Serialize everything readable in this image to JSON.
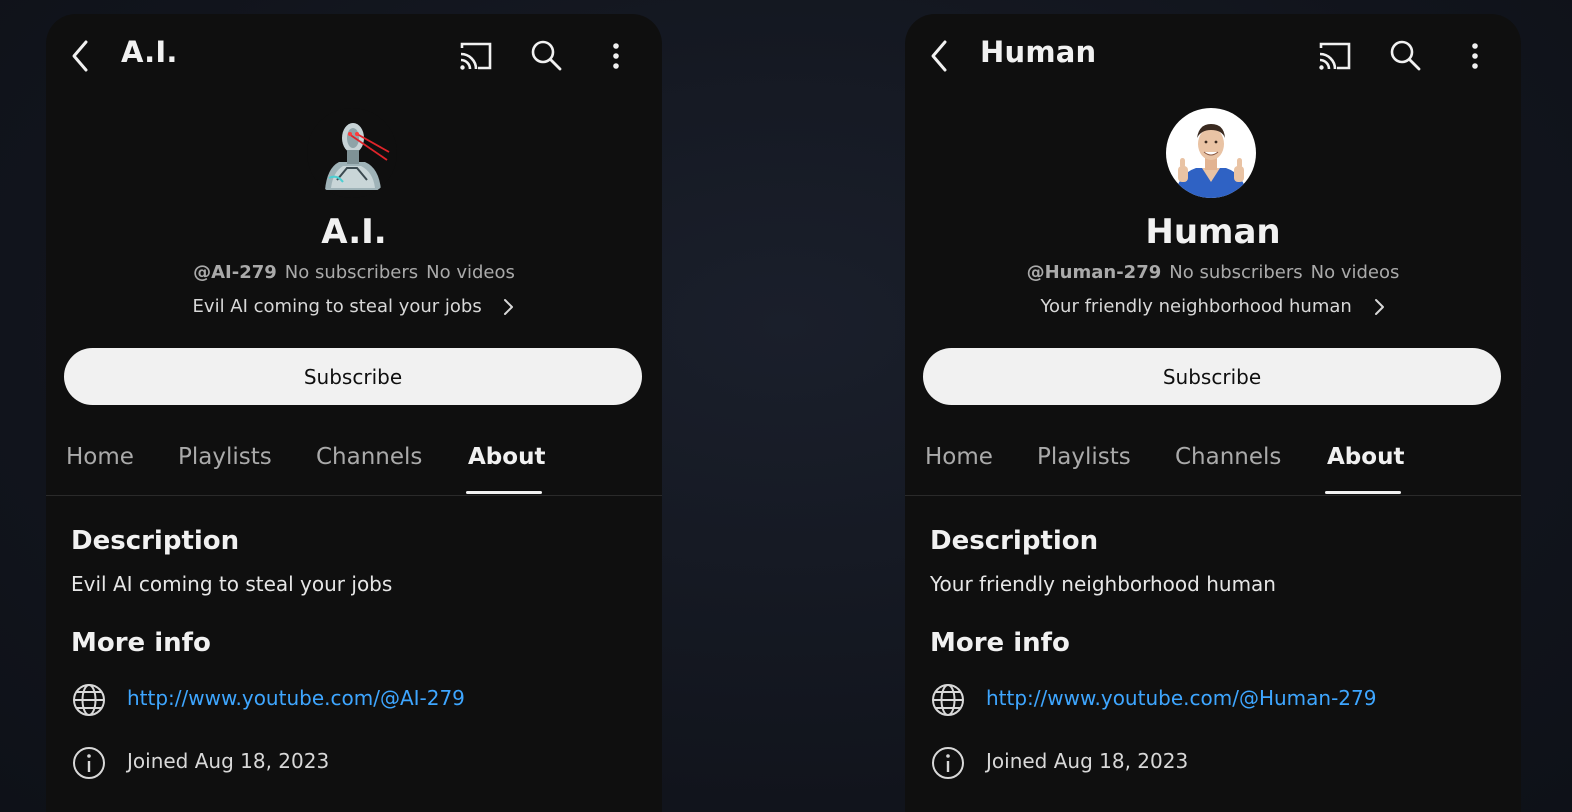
{
  "panels": [
    {
      "top_title": "A.I.",
      "channel_name": "A.I.",
      "handle": "@AI-279",
      "subscribers": "No subscribers",
      "videos": "No videos",
      "tagline": "Evil AI coming to steal your jobs",
      "subscribe_label": "Subscribe",
      "tabs": [
        "Home",
        "Playlists",
        "Channels",
        "About"
      ],
      "active_tab": "About",
      "description_heading": "Description",
      "description": "Evil AI coming to steal your jobs",
      "more_info_heading": "More info",
      "link": "http://www.youtube.com/@AI-279",
      "joined": "Joined Aug 18, 2023",
      "avatar": "robot-avatar"
    },
    {
      "top_title": "Human",
      "channel_name": "Human",
      "handle": "@Human-279",
      "subscribers": "No subscribers",
      "videos": "No videos",
      "tagline": "Your friendly neighborhood human",
      "subscribe_label": "Subscribe",
      "tabs": [
        "Home",
        "Playlists",
        "Channels",
        "About"
      ],
      "active_tab": "About",
      "description_heading": "Description",
      "description": "Your friendly neighborhood human",
      "more_info_heading": "More info",
      "link": "http://www.youtube.com/@Human-279",
      "joined": "Joined Aug 18, 2023",
      "avatar": "human-avatar"
    }
  ],
  "colors": {
    "background": "#0f0f0f",
    "text": "#f1f1f1",
    "secondary_text": "#aaaaaa",
    "link": "#3ea6ff",
    "subscribe_bg": "#f1f1f1"
  }
}
